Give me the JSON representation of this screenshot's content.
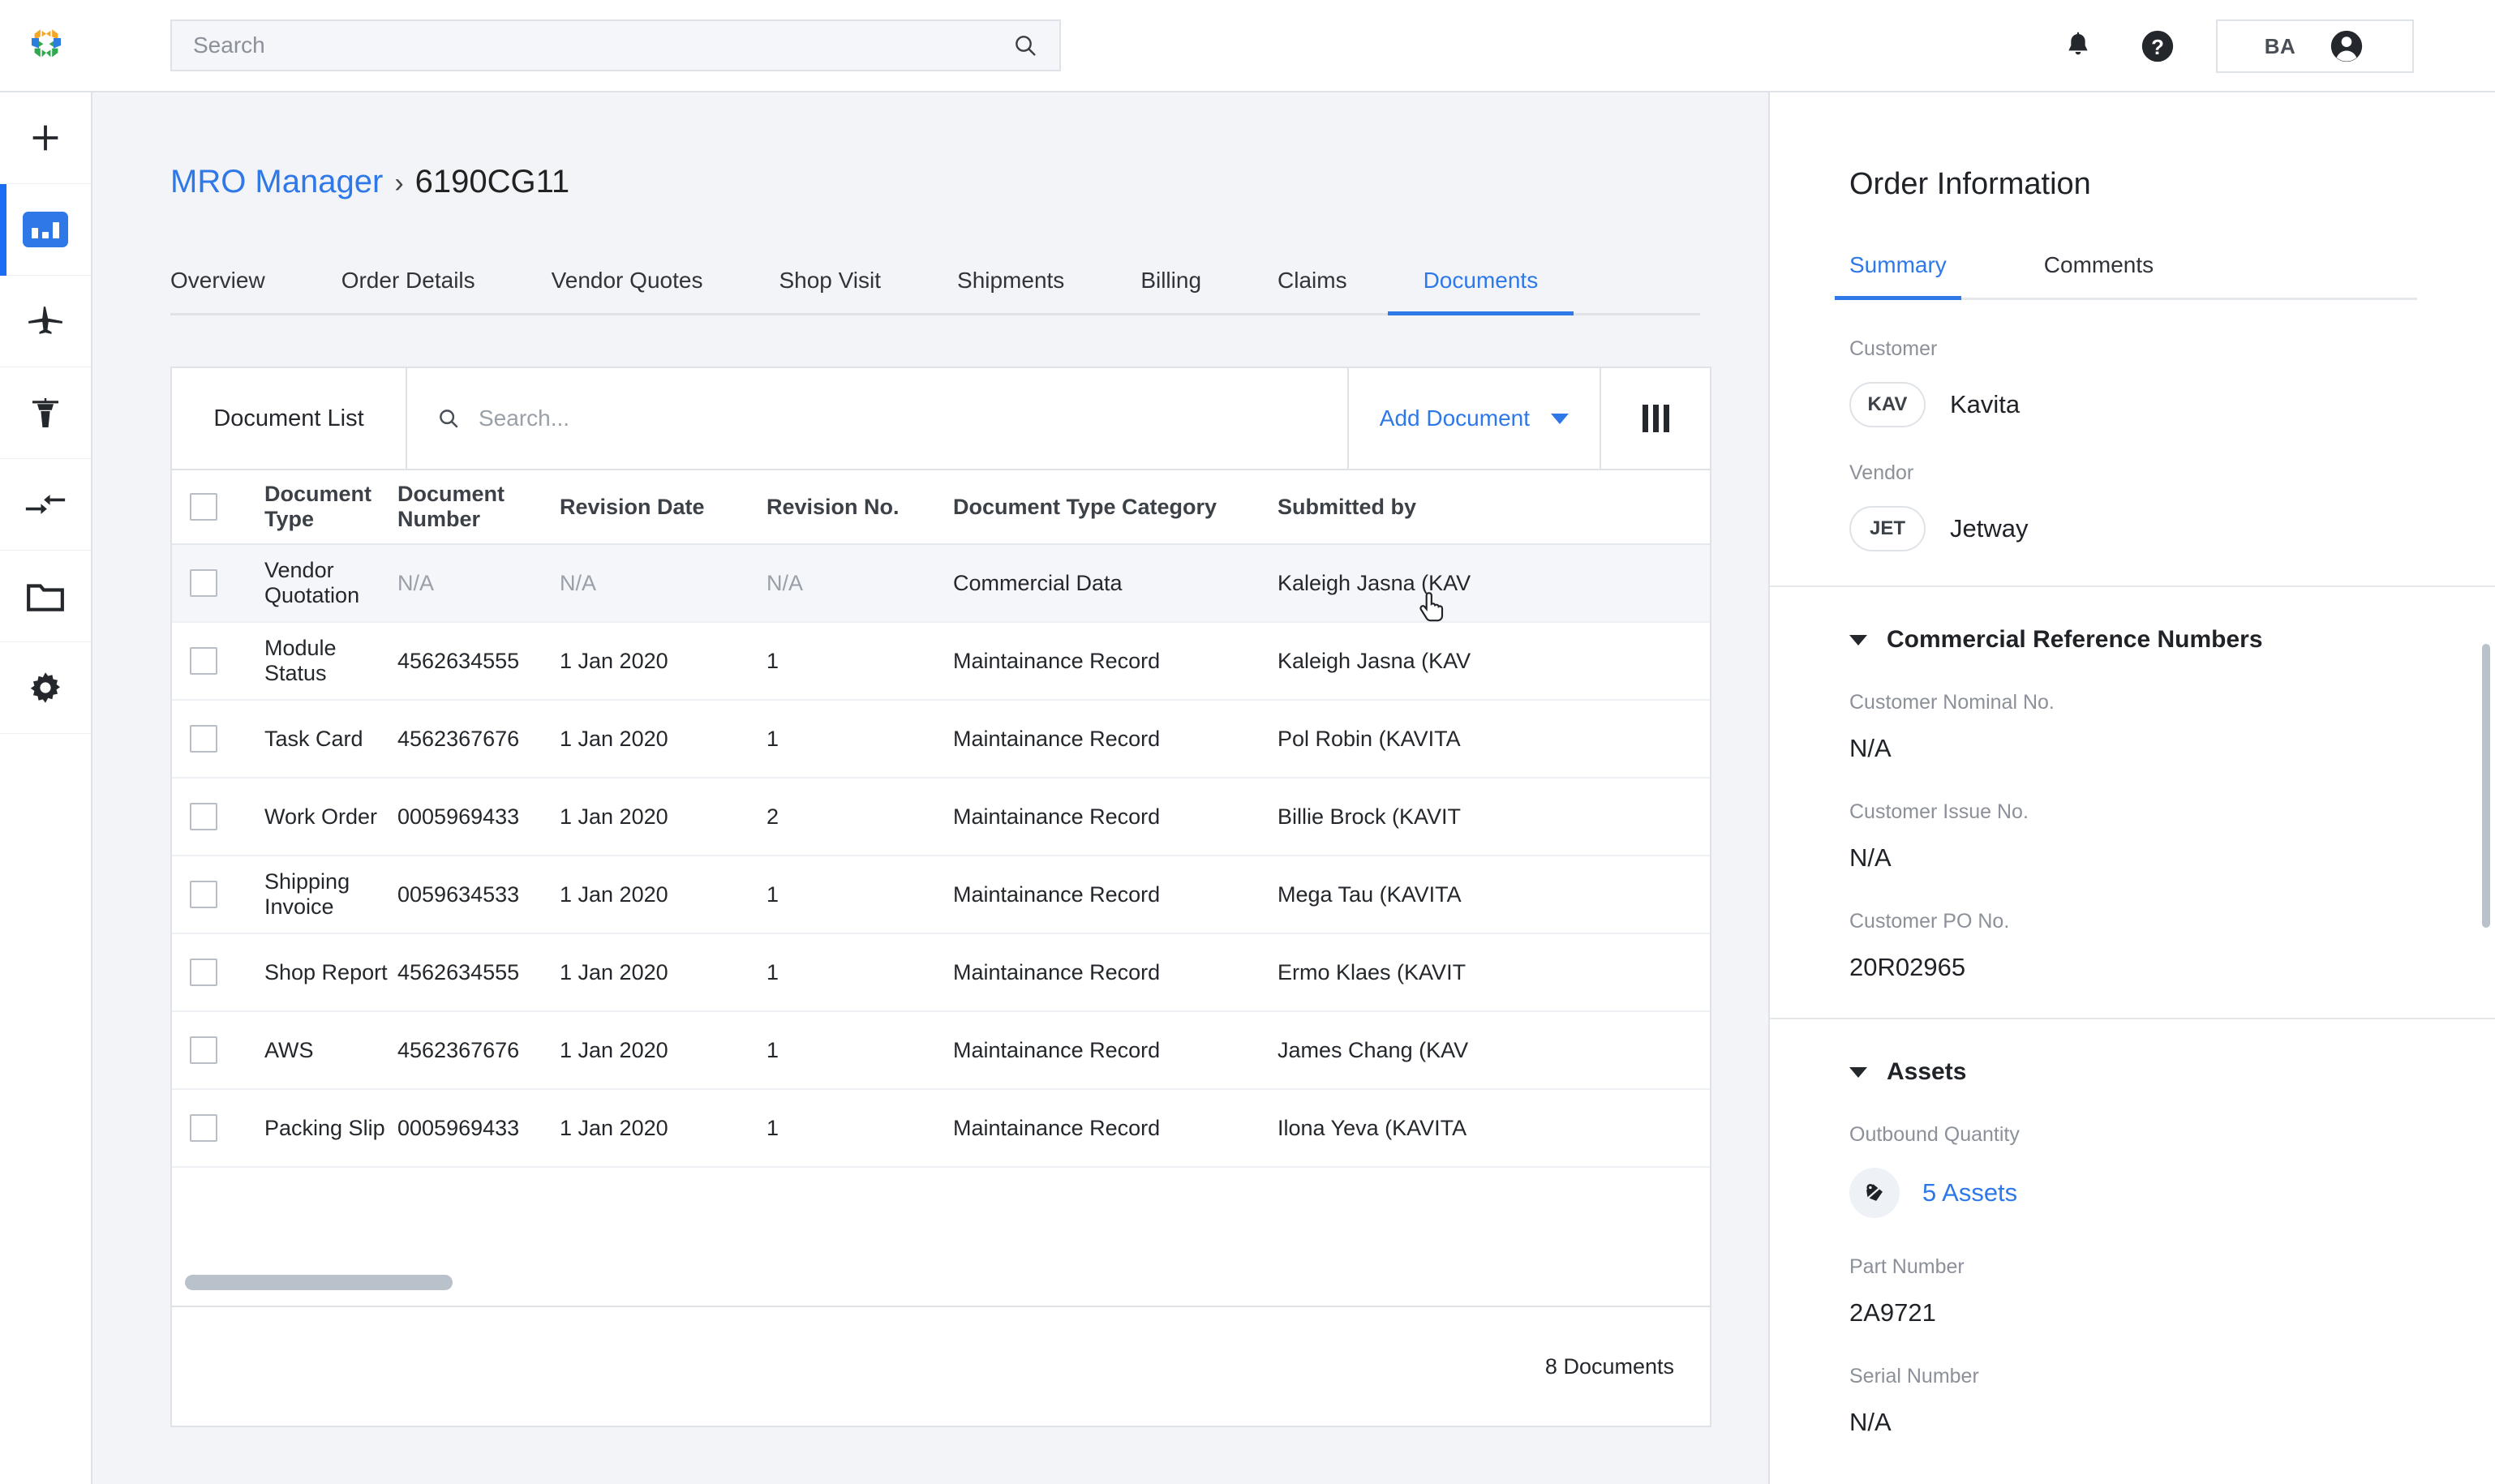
{
  "topbar": {
    "logo_name": "app-logo",
    "search_placeholder": "Search",
    "search_value": "",
    "notifications_icon": "bell-icon",
    "help_icon": "question-circle-icon",
    "user_initials": "BA",
    "avatar_icon": "person-circle-icon"
  },
  "sidebar": {
    "items": [
      {
        "icon": "plus-icon",
        "name": "add"
      },
      {
        "icon": "bar-chart-icon",
        "name": "dashboard",
        "active": true
      },
      {
        "icon": "airplane-icon",
        "name": "fleet"
      },
      {
        "icon": "control-tower-icon",
        "name": "operations"
      },
      {
        "icon": "transfer-arrows-icon",
        "name": "transfers"
      },
      {
        "icon": "folder-icon",
        "name": "files"
      },
      {
        "icon": "gear-icon",
        "name": "settings"
      }
    ]
  },
  "breadcrumb": {
    "parent": "MRO Manager",
    "separator": "›",
    "current": "6190CG11"
  },
  "tabs": [
    {
      "label": "Overview",
      "active": false
    },
    {
      "label": "Order Details",
      "active": false
    },
    {
      "label": "Vendor Quotes",
      "active": false
    },
    {
      "label": "Shop Visit",
      "active": false
    },
    {
      "label": "Shipments",
      "active": false
    },
    {
      "label": "Billing",
      "active": false
    },
    {
      "label": "Claims",
      "active": false
    },
    {
      "label": "Documents",
      "active": true
    }
  ],
  "document_list": {
    "title": "Document List",
    "search_placeholder": "Search...",
    "search_value": "",
    "add_document_label": "Add Document",
    "columns_icon": "columns-icon",
    "columns": [
      "Document Type",
      "Document Number",
      "Revision Date",
      "Revision No.",
      "Document Type Category",
      "Submitted by"
    ],
    "rows": [
      {
        "type": "Vendor Quotation",
        "number": "N/A",
        "revision_date": "N/A",
        "revision_no": "N/A",
        "category": "Commercial Data",
        "submitted_by": "Kaleigh Jasna (KAV",
        "hovered": true,
        "muted": true
      },
      {
        "type": "Module Status",
        "number": "4562634555",
        "revision_date": "1 Jan 2020",
        "revision_no": "1",
        "category": "Maintainance Record",
        "submitted_by": "Kaleigh Jasna (KAV"
      },
      {
        "type": "Task Card",
        "number": "4562367676",
        "revision_date": "1 Jan 2020",
        "revision_no": "1",
        "category": "Maintainance Record",
        "submitted_by": "Pol Robin (KAVITA"
      },
      {
        "type": "Work Order",
        "number": "0005969433",
        "revision_date": "1 Jan 2020",
        "revision_no": "2",
        "category": "Maintainance Record",
        "submitted_by": "Billie Brock (KAVIT"
      },
      {
        "type": "Shipping Invoice",
        "number": "0059634533",
        "revision_date": "1 Jan 2020",
        "revision_no": "1",
        "category": "Maintainance Record",
        "submitted_by": "Mega Tau (KAVITA"
      },
      {
        "type": "Shop Report",
        "number": "4562634555",
        "revision_date": "1 Jan 2020",
        "revision_no": "1",
        "category": "Maintainance Record",
        "submitted_by": "Ermo Klaes (KAVIT"
      },
      {
        "type": "AWS",
        "number": "4562367676",
        "revision_date": "1 Jan 2020",
        "revision_no": "1",
        "category": "Maintainance Record",
        "submitted_by": "James Chang (KAV"
      },
      {
        "type": "Packing Slip",
        "number": "0005969433",
        "revision_date": "1 Jan 2020",
        "revision_no": "1",
        "category": "Maintainance Record",
        "submitted_by": "Ilona Yeva (KAVITA"
      }
    ],
    "footer_count": "8 Documents"
  },
  "panel": {
    "title": "Order Information",
    "tabs": [
      {
        "label": "Summary",
        "active": true
      },
      {
        "label": "Comments",
        "active": false
      }
    ],
    "customer": {
      "label": "Customer",
      "code": "KAV",
      "name": "Kavita"
    },
    "vendor": {
      "label": "Vendor",
      "code": "JET",
      "name": "Jetway"
    },
    "commercial": {
      "heading": "Commercial Reference Numbers",
      "fields": [
        {
          "label": "Customer Nominal No.",
          "value": "N/A"
        },
        {
          "label": "Customer Issue No.",
          "value": "N/A"
        },
        {
          "label": "Customer PO No.",
          "value": "20R02965"
        }
      ]
    },
    "assets": {
      "heading": "Assets",
      "outbound_label": "Outbound Quantity",
      "outbound_icon": "asset-icon",
      "outbound_value": "5 Assets",
      "fields": [
        {
          "label": "Part Number",
          "value": "2A9721"
        },
        {
          "label": "Serial Number",
          "value": "N/A"
        }
      ]
    }
  },
  "colors": {
    "accent": "#2e78e8",
    "link": "#2e78e8",
    "page_bg": "#f2f4f8",
    "border": "#dfe3e8",
    "text": "#24272b",
    "muted": "#8b9099"
  }
}
